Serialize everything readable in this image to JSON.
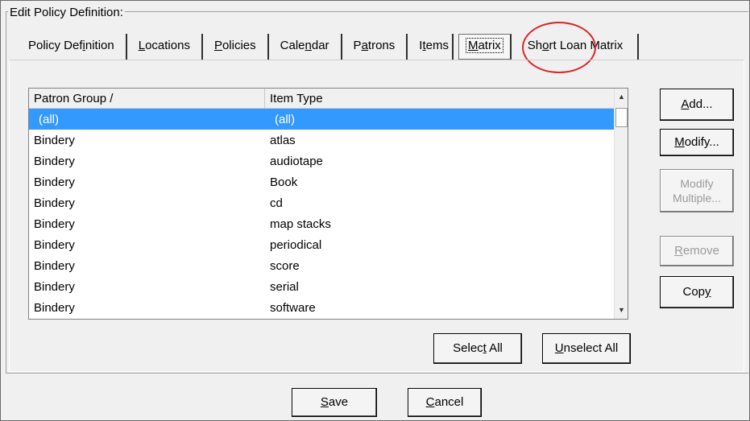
{
  "dialog": {
    "group_label": "Edit Policy Definition:"
  },
  "tabs": [
    {
      "label": "Policy Definition",
      "prefix": "Policy Def",
      "accel": "i",
      "suffix": "nition"
    },
    {
      "label": "Locations",
      "prefix": "",
      "accel": "L",
      "suffix": "ocations"
    },
    {
      "label": "Policies",
      "prefix": "",
      "accel": "P",
      "suffix": "olicies"
    },
    {
      "label": "Calendar",
      "prefix": "Cale",
      "accel": "n",
      "suffix": "dar"
    },
    {
      "label": "Patrons",
      "prefix": "P",
      "accel": "a",
      "suffix": "trons"
    },
    {
      "label": "Items",
      "prefix": "I",
      "accel": "t",
      "suffix": "ems"
    },
    {
      "label": "Matrix",
      "prefix": "",
      "accel": "M",
      "suffix": "atrix"
    },
    {
      "label": "Short Loan Matrix",
      "prefix": "Sh",
      "accel": "o",
      "suffix": "rt Loan Matrix"
    }
  ],
  "active_tab": "Matrix",
  "table": {
    "columns": [
      "Patron Group /",
      "Item Type"
    ],
    "rows": [
      [
        "(all)",
        "(all)"
      ],
      [
        "Bindery",
        "atlas"
      ],
      [
        "Bindery",
        "audiotape"
      ],
      [
        "Bindery",
        "Book"
      ],
      [
        "Bindery",
        "cd"
      ],
      [
        "Bindery",
        "map stacks"
      ],
      [
        "Bindery",
        "periodical"
      ],
      [
        "Bindery",
        "score"
      ],
      [
        "Bindery",
        "serial"
      ],
      [
        "Bindery",
        "software"
      ]
    ],
    "selected_row": 0
  },
  "buttons": {
    "add": {
      "prefix": "",
      "accel": "A",
      "suffix": "dd..."
    },
    "modify": {
      "prefix": "",
      "accel": "M",
      "suffix": "odify..."
    },
    "modify_multiple": {
      "line1": "Modify",
      "line2": "Multiple...",
      "enabled": false
    },
    "remove": {
      "prefix": "",
      "accel": "R",
      "suffix": "emove",
      "enabled": false
    },
    "copy": {
      "prefix": "Cop",
      "accel": "y",
      "suffix": ""
    },
    "select_all": {
      "prefix": "Selec",
      "accel": "t",
      "suffix": " All"
    },
    "unselect_all": {
      "prefix": "",
      "accel": "U",
      "suffix": "nselect All"
    },
    "save": {
      "prefix": "",
      "accel": "S",
      "suffix": "ave"
    },
    "cancel": {
      "prefix": "",
      "accel": "C",
      "suffix": "ancel"
    }
  },
  "colors": {
    "selection": "#3399ff",
    "annotation_circle": "#d6262b",
    "dialog_bg": "#f0f0f0"
  },
  "icons": {
    "scroll_up": "▲",
    "scroll_down": "▼"
  }
}
